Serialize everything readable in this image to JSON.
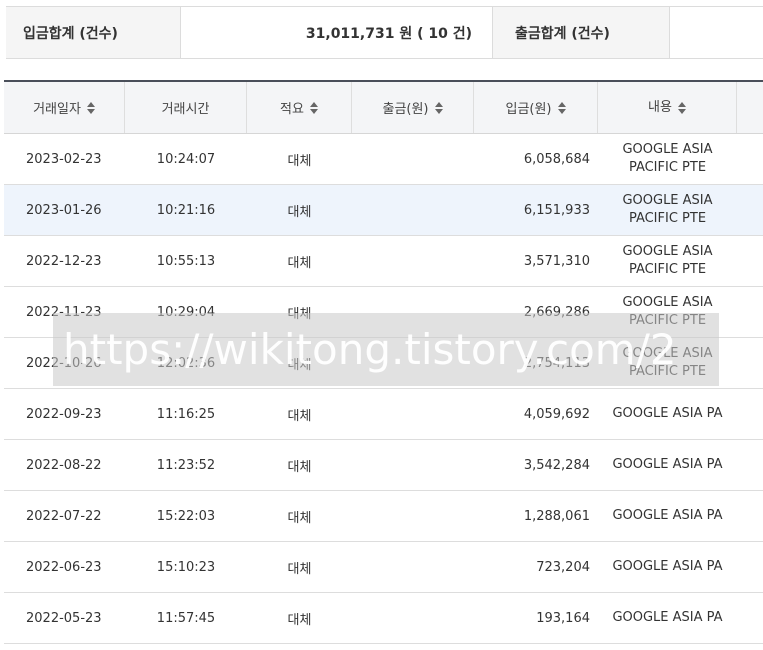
{
  "summary": {
    "deposit_label": "입금합계 (건수)",
    "deposit_value": "31,011,731 원 ( 10 건)",
    "withdraw_label": "출금합계 (건수)",
    "withdraw_value": ""
  },
  "table": {
    "headers": [
      "거래일자",
      "거래시간",
      "적요",
      "출금(원)",
      "입금(원)",
      "내용"
    ],
    "sort_icon": "sort-updown-icon",
    "highlight_row_color": "#eef4fc",
    "rows": [
      {
        "date": "2023-02-23",
        "time": "10:24:07",
        "memo": "대체",
        "withdraw": "",
        "deposit": "6,058,684",
        "content": "GOOGLE ASIA PACIFIC PTE"
      },
      {
        "date": "2023-01-26",
        "time": "10:21:16",
        "memo": "대체",
        "withdraw": "",
        "deposit": "6,151,933",
        "content": "GOOGLE ASIA PACIFIC PTE"
      },
      {
        "date": "2022-12-23",
        "time": "10:55:13",
        "memo": "대체",
        "withdraw": "",
        "deposit": "3,571,310",
        "content": "GOOGLE ASIA PACIFIC PTE"
      },
      {
        "date": "2022-11-23",
        "time": "10:29:04",
        "memo": "대체",
        "withdraw": "",
        "deposit": "2,669,286",
        "content": "GOOGLE ASIA PACIFIC PTE"
      },
      {
        "date": "2022-10-26",
        "time": "12:02:36",
        "memo": "대체",
        "withdraw": "",
        "deposit": "2,754,113",
        "content": "GOOGLE ASIA PACIFIC PTE"
      },
      {
        "date": "2022-09-23",
        "time": "11:16:25",
        "memo": "대체",
        "withdraw": "",
        "deposit": "4,059,692",
        "content": "GOOGLE ASIA PA"
      },
      {
        "date": "2022-08-22",
        "time": "11:23:52",
        "memo": "대체",
        "withdraw": "",
        "deposit": "3,542,284",
        "content": "GOOGLE ASIA PA"
      },
      {
        "date": "2022-07-22",
        "time": "15:22:03",
        "memo": "대체",
        "withdraw": "",
        "deposit": "1,288,061",
        "content": "GOOGLE ASIA PA"
      },
      {
        "date": "2022-06-23",
        "time": "15:10:23",
        "memo": "대체",
        "withdraw": "",
        "deposit": "723,204",
        "content": "GOOGLE ASIA PA"
      },
      {
        "date": "2022-05-23",
        "time": "11:57:45",
        "memo": "대체",
        "withdraw": "",
        "deposit": "193,164",
        "content": "GOOGLE ASIA PA"
      }
    ]
  },
  "watermark": "https://wikitong.tistory.com/2"
}
